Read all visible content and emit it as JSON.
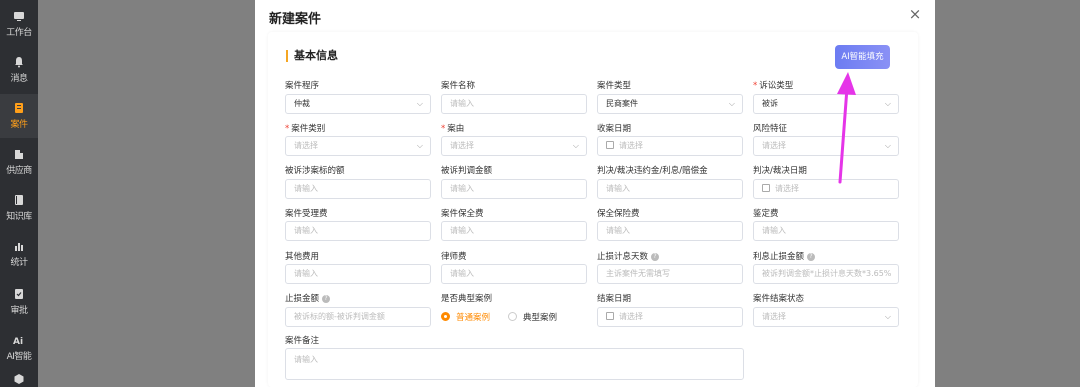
{
  "sidebar": {
    "items": [
      {
        "label": "工作台",
        "icon": "workbench-icon"
      },
      {
        "label": "消息",
        "icon": "bell-icon"
      },
      {
        "label": "案件",
        "icon": "case-icon",
        "active": true
      },
      {
        "label": "供应商",
        "icon": "building-icon"
      },
      {
        "label": "知识库",
        "icon": "book-icon"
      },
      {
        "label": "统计",
        "icon": "chart-icon"
      },
      {
        "label": "审批",
        "icon": "approve-icon"
      },
      {
        "label": "AI智能",
        "icon": "ai-icon"
      }
    ]
  },
  "modal": {
    "title": "新建案件",
    "close": "×",
    "section_title": "基本信息",
    "ai_button": "AI智能填充"
  },
  "fields": [
    {
      "label": "案件程序",
      "required": false,
      "value": "仲裁",
      "type": "select"
    },
    {
      "label": "案件名称",
      "required": false,
      "placeholder": "请输入",
      "type": "input"
    },
    {
      "label": "案件类型",
      "required": false,
      "value": "民商案件",
      "type": "select"
    },
    {
      "label": "诉讼类型",
      "required": true,
      "value": "被诉",
      "type": "select"
    },
    {
      "label": "案件类别",
      "required": true,
      "placeholder": "请选择",
      "type": "select"
    },
    {
      "label": "案由",
      "required": true,
      "placeholder": "请选择",
      "type": "select"
    },
    {
      "label": "收案日期",
      "required": false,
      "placeholder": "请选择",
      "type": "date"
    },
    {
      "label": "风险特征",
      "required": false,
      "placeholder": "请选择",
      "type": "select"
    },
    {
      "label": "被诉涉案标的额",
      "required": false,
      "placeholder": "请输入",
      "type": "input"
    },
    {
      "label": "被诉判调金额",
      "required": false,
      "placeholder": "请输入",
      "type": "input"
    },
    {
      "label": "判决/裁决违约金/利息/赔偿金",
      "required": false,
      "placeholder": "请输入",
      "type": "input"
    },
    {
      "label": "判决/裁决日期",
      "required": false,
      "placeholder": "请选择",
      "type": "date"
    },
    {
      "label": "案件受理费",
      "required": false,
      "placeholder": "请输入",
      "type": "input"
    },
    {
      "label": "案件保全费",
      "required": false,
      "placeholder": "请输入",
      "type": "input"
    },
    {
      "label": "保全保险费",
      "required": false,
      "placeholder": "请输入",
      "type": "input"
    },
    {
      "label": "鉴定费",
      "required": false,
      "placeholder": "请输入",
      "type": "input"
    },
    {
      "label": "其他费用",
      "required": false,
      "placeholder": "请输入",
      "type": "input"
    },
    {
      "label": "律师费",
      "required": false,
      "placeholder": "请输入",
      "type": "input"
    },
    {
      "label": "止损计息天数",
      "required": false,
      "help": true,
      "placeholder": "主诉案件无需填写",
      "type": "input"
    },
    {
      "label": "利息止损金额",
      "required": false,
      "help": true,
      "placeholder": "被诉判调金额*止损计息天数*3.65%",
      "type": "input"
    },
    {
      "label": "止损金额",
      "required": false,
      "help": true,
      "placeholder": "被诉标的额-被诉判调金额",
      "type": "input"
    },
    {
      "label": "是否典型案例",
      "required": false,
      "type": "radio"
    },
    {
      "label": "结案日期",
      "required": false,
      "placeholder": "请选择",
      "type": "date"
    },
    {
      "label": "案件结案状态",
      "required": false,
      "placeholder": "请选择",
      "type": "select"
    }
  ],
  "typical_case": {
    "options": [
      "普通案例",
      "典型案例"
    ],
    "selected": "普通案例"
  },
  "remarks": {
    "label": "案件备注",
    "placeholder": "请输入"
  },
  "colors": {
    "accent": "#ff8a00",
    "ai_button": "#7b86f3",
    "arrow": "#e535e8",
    "sidebar": "#2d2f33"
  }
}
